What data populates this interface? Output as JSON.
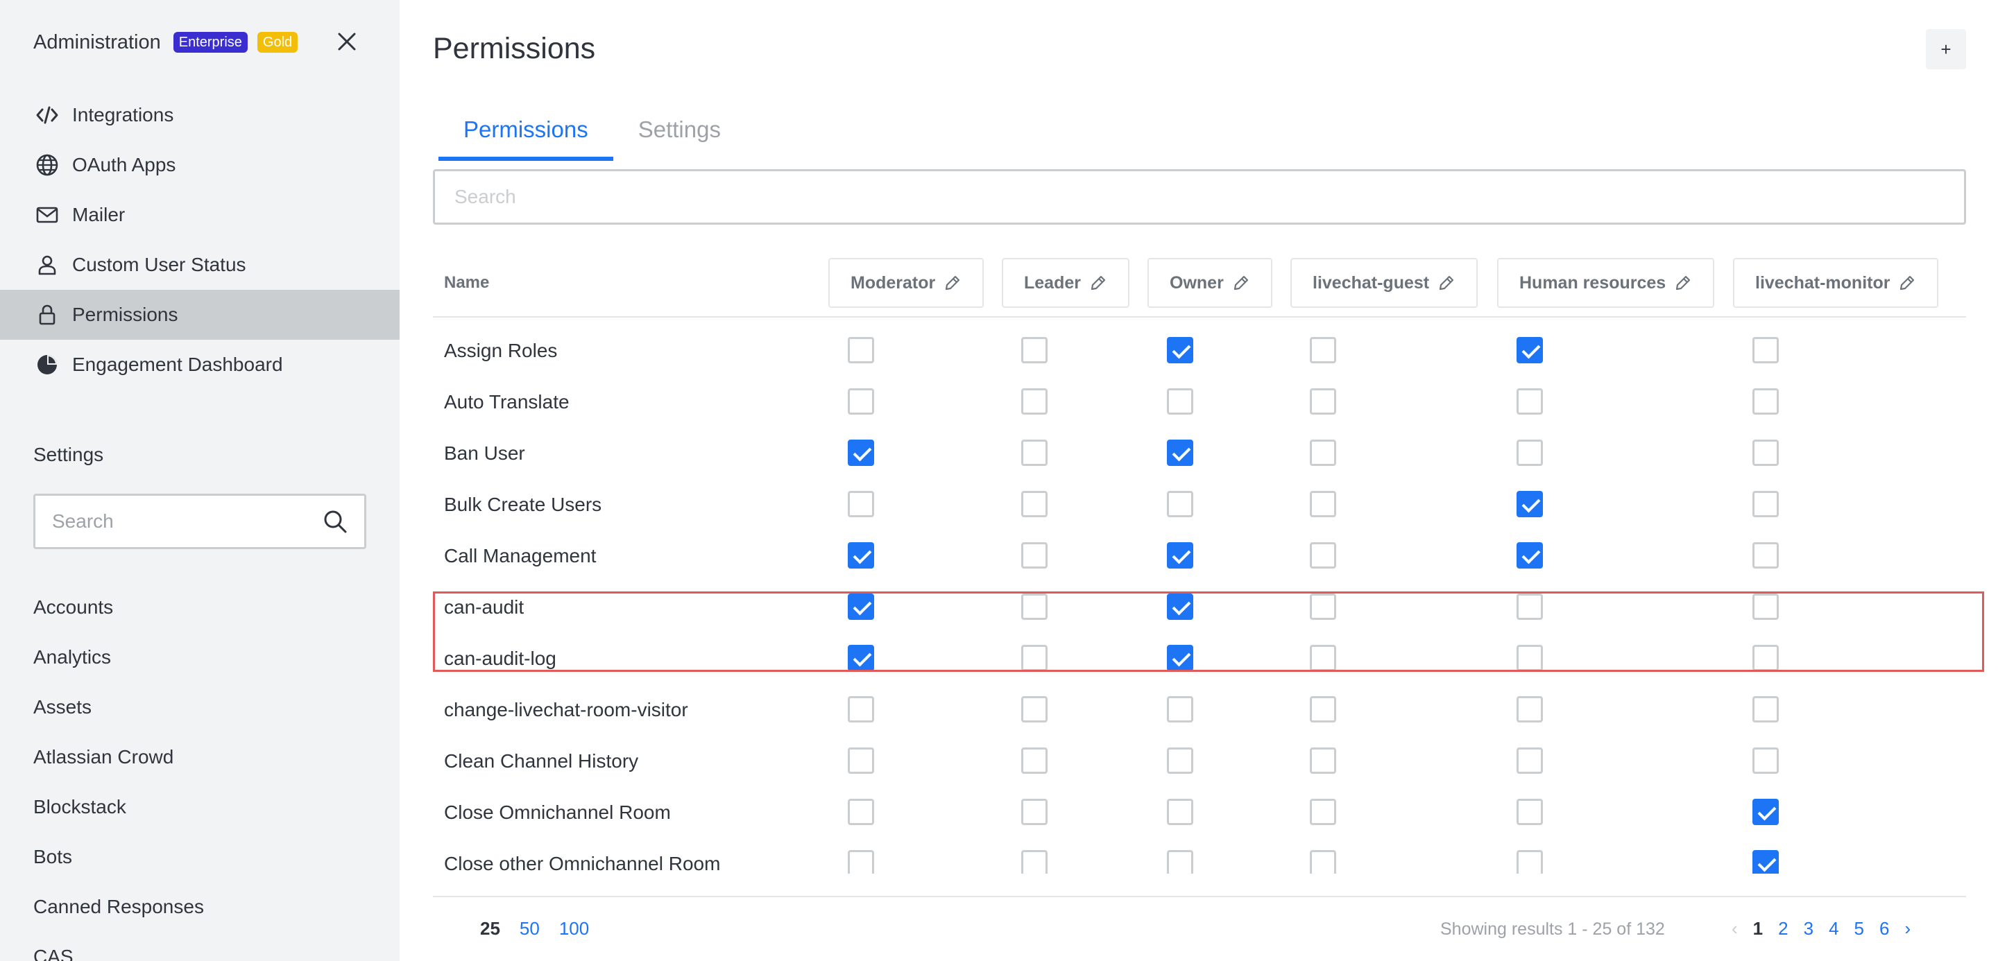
{
  "sidebar": {
    "title": "Administration",
    "badges": [
      "Enterprise",
      "Gold"
    ],
    "nav": [
      {
        "label": "Integrations",
        "icon": "code-icon"
      },
      {
        "label": "OAuth Apps",
        "icon": "globe-icon"
      },
      {
        "label": "Mailer",
        "icon": "mail-icon"
      },
      {
        "label": "Custom User Status",
        "icon": "user-icon"
      },
      {
        "label": "Permissions",
        "icon": "lock-icon",
        "active": true
      },
      {
        "label": "Engagement Dashboard",
        "icon": "pie-chart-icon"
      }
    ],
    "settings_label": "Settings",
    "search_placeholder": "Search",
    "groups": [
      "Accounts",
      "Analytics",
      "Assets",
      "Atlassian Crowd",
      "Blockstack",
      "Bots",
      "Canned Responses",
      "CAS"
    ]
  },
  "main": {
    "title": "Permissions",
    "add_label": "+",
    "tabs": [
      {
        "label": "Permissions",
        "active": true
      },
      {
        "label": "Settings"
      }
    ],
    "search_placeholder": "Search",
    "table": {
      "name_header": "Name",
      "roles": [
        "Moderator",
        "Leader",
        "Owner",
        "livechat-guest",
        "Human resources",
        "livechat-monitor"
      ],
      "rows": [
        {
          "name": "Assign Roles",
          "checks": [
            false,
            false,
            true,
            false,
            true,
            false
          ]
        },
        {
          "name": "Auto Translate",
          "checks": [
            false,
            false,
            false,
            false,
            false,
            false
          ]
        },
        {
          "name": "Ban User",
          "checks": [
            true,
            false,
            true,
            false,
            false,
            false
          ]
        },
        {
          "name": "Bulk Create Users",
          "checks": [
            false,
            false,
            false,
            false,
            true,
            false
          ]
        },
        {
          "name": "Call Management",
          "checks": [
            true,
            false,
            true,
            false,
            true,
            false
          ]
        },
        {
          "name": "can-audit",
          "checks": [
            true,
            false,
            true,
            false,
            false,
            false
          ]
        },
        {
          "name": "can-audit-log",
          "checks": [
            true,
            false,
            true,
            false,
            false,
            false
          ]
        },
        {
          "name": "change-livechat-room-visitor",
          "checks": [
            false,
            false,
            false,
            false,
            false,
            false
          ]
        },
        {
          "name": "Clean Channel History",
          "checks": [
            false,
            false,
            false,
            false,
            false,
            false
          ]
        },
        {
          "name": "Close Omnichannel Room",
          "checks": [
            false,
            false,
            false,
            false,
            false,
            true
          ]
        },
        {
          "name": "Close other Omnichannel Room",
          "checks": [
            false,
            false,
            false,
            false,
            false,
            true
          ]
        }
      ]
    },
    "pagination": {
      "per_page": [
        "25",
        "50",
        "100"
      ],
      "per_page_current": "25",
      "showing": "Showing results 1 - 25 of 132",
      "pages": [
        "1",
        "2",
        "3",
        "4",
        "5",
        "6"
      ],
      "current_page": "1",
      "prev": "‹",
      "next": "›"
    }
  },
  "colors": {
    "accent": "#1d74f5",
    "enterprise": "#3b2ed0",
    "gold": "#f3be08",
    "highlight": "#e05a5a"
  }
}
